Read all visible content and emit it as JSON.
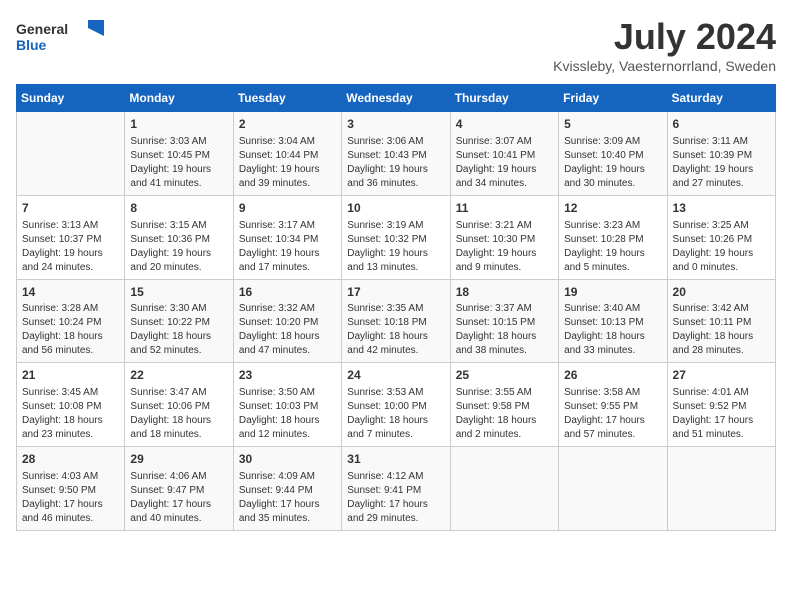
{
  "logo": {
    "general": "General",
    "blue": "Blue"
  },
  "header": {
    "month": "July 2024",
    "location": "Kvissleby, Vaesternorrland, Sweden"
  },
  "columns": [
    "Sunday",
    "Monday",
    "Tuesday",
    "Wednesday",
    "Thursday",
    "Friday",
    "Saturday"
  ],
  "weeks": [
    [
      {
        "day": "",
        "info": ""
      },
      {
        "day": "1",
        "info": "Sunrise: 3:03 AM\nSunset: 10:45 PM\nDaylight: 19 hours\nand 41 minutes."
      },
      {
        "day": "2",
        "info": "Sunrise: 3:04 AM\nSunset: 10:44 PM\nDaylight: 19 hours\nand 39 minutes."
      },
      {
        "day": "3",
        "info": "Sunrise: 3:06 AM\nSunset: 10:43 PM\nDaylight: 19 hours\nand 36 minutes."
      },
      {
        "day": "4",
        "info": "Sunrise: 3:07 AM\nSunset: 10:41 PM\nDaylight: 19 hours\nand 34 minutes."
      },
      {
        "day": "5",
        "info": "Sunrise: 3:09 AM\nSunset: 10:40 PM\nDaylight: 19 hours\nand 30 minutes."
      },
      {
        "day": "6",
        "info": "Sunrise: 3:11 AM\nSunset: 10:39 PM\nDaylight: 19 hours\nand 27 minutes."
      }
    ],
    [
      {
        "day": "7",
        "info": "Sunrise: 3:13 AM\nSunset: 10:37 PM\nDaylight: 19 hours\nand 24 minutes."
      },
      {
        "day": "8",
        "info": "Sunrise: 3:15 AM\nSunset: 10:36 PM\nDaylight: 19 hours\nand 20 minutes."
      },
      {
        "day": "9",
        "info": "Sunrise: 3:17 AM\nSunset: 10:34 PM\nDaylight: 19 hours\nand 17 minutes."
      },
      {
        "day": "10",
        "info": "Sunrise: 3:19 AM\nSunset: 10:32 PM\nDaylight: 19 hours\nand 13 minutes."
      },
      {
        "day": "11",
        "info": "Sunrise: 3:21 AM\nSunset: 10:30 PM\nDaylight: 19 hours\nand 9 minutes."
      },
      {
        "day": "12",
        "info": "Sunrise: 3:23 AM\nSunset: 10:28 PM\nDaylight: 19 hours\nand 5 minutes."
      },
      {
        "day": "13",
        "info": "Sunrise: 3:25 AM\nSunset: 10:26 PM\nDaylight: 19 hours\nand 0 minutes."
      }
    ],
    [
      {
        "day": "14",
        "info": "Sunrise: 3:28 AM\nSunset: 10:24 PM\nDaylight: 18 hours\nand 56 minutes."
      },
      {
        "day": "15",
        "info": "Sunrise: 3:30 AM\nSunset: 10:22 PM\nDaylight: 18 hours\nand 52 minutes."
      },
      {
        "day": "16",
        "info": "Sunrise: 3:32 AM\nSunset: 10:20 PM\nDaylight: 18 hours\nand 47 minutes."
      },
      {
        "day": "17",
        "info": "Sunrise: 3:35 AM\nSunset: 10:18 PM\nDaylight: 18 hours\nand 42 minutes."
      },
      {
        "day": "18",
        "info": "Sunrise: 3:37 AM\nSunset: 10:15 PM\nDaylight: 18 hours\nand 38 minutes."
      },
      {
        "day": "19",
        "info": "Sunrise: 3:40 AM\nSunset: 10:13 PM\nDaylight: 18 hours\nand 33 minutes."
      },
      {
        "day": "20",
        "info": "Sunrise: 3:42 AM\nSunset: 10:11 PM\nDaylight: 18 hours\nand 28 minutes."
      }
    ],
    [
      {
        "day": "21",
        "info": "Sunrise: 3:45 AM\nSunset: 10:08 PM\nDaylight: 18 hours\nand 23 minutes."
      },
      {
        "day": "22",
        "info": "Sunrise: 3:47 AM\nSunset: 10:06 PM\nDaylight: 18 hours\nand 18 minutes."
      },
      {
        "day": "23",
        "info": "Sunrise: 3:50 AM\nSunset: 10:03 PM\nDaylight: 18 hours\nand 12 minutes."
      },
      {
        "day": "24",
        "info": "Sunrise: 3:53 AM\nSunset: 10:00 PM\nDaylight: 18 hours\nand 7 minutes."
      },
      {
        "day": "25",
        "info": "Sunrise: 3:55 AM\nSunset: 9:58 PM\nDaylight: 18 hours\nand 2 minutes."
      },
      {
        "day": "26",
        "info": "Sunrise: 3:58 AM\nSunset: 9:55 PM\nDaylight: 17 hours\nand 57 minutes."
      },
      {
        "day": "27",
        "info": "Sunrise: 4:01 AM\nSunset: 9:52 PM\nDaylight: 17 hours\nand 51 minutes."
      }
    ],
    [
      {
        "day": "28",
        "info": "Sunrise: 4:03 AM\nSunset: 9:50 PM\nDaylight: 17 hours\nand 46 minutes."
      },
      {
        "day": "29",
        "info": "Sunrise: 4:06 AM\nSunset: 9:47 PM\nDaylight: 17 hours\nand 40 minutes."
      },
      {
        "day": "30",
        "info": "Sunrise: 4:09 AM\nSunset: 9:44 PM\nDaylight: 17 hours\nand 35 minutes."
      },
      {
        "day": "31",
        "info": "Sunrise: 4:12 AM\nSunset: 9:41 PM\nDaylight: 17 hours\nand 29 minutes."
      },
      {
        "day": "",
        "info": ""
      },
      {
        "day": "",
        "info": ""
      },
      {
        "day": "",
        "info": ""
      }
    ]
  ]
}
